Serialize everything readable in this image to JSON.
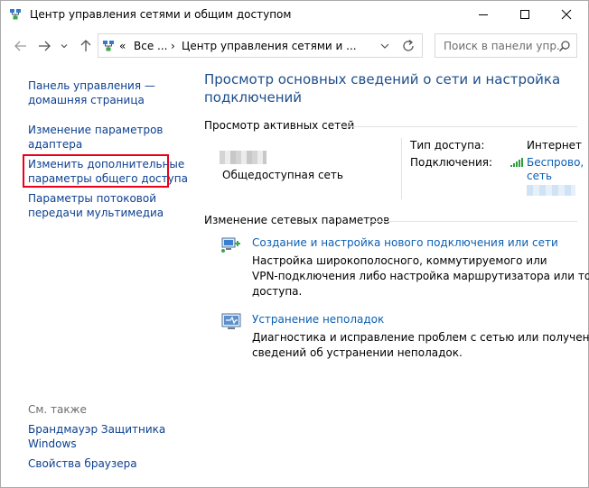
{
  "window": {
    "title": "Центр управления сетями и общим доступом"
  },
  "address": {
    "chevrons": "«",
    "crumb1": "Все ...",
    "sep": "›",
    "crumb2": "Центр управления сетями и ..."
  },
  "search": {
    "placeholder": "Поиск в панели упр..."
  },
  "sidebar": {
    "home": [
      "Панель управления —",
      "домашняя страница"
    ],
    "adapter": [
      "Изменение параметров",
      "адаптера"
    ],
    "sharing": [
      "Изменить дополнительные",
      "параметры общего доступа"
    ],
    "streaming": [
      "Параметры потоковой",
      "передачи мультимедиа"
    ],
    "see_also": "См. также",
    "firewall": [
      "Брандмауэр Защитника",
      "Windows"
    ],
    "browser": "Свойства браузера"
  },
  "main": {
    "heading": [
      "Просмотр основных сведений о сети и настройка",
      "подключений"
    ],
    "active_networks_label": "Просмотр активных сетей",
    "network_type": "Общедоступная сеть",
    "access_type_label": "Тип доступа:",
    "access_type_value": "Интернет",
    "connections_label": "Подключения:",
    "connection_value": [
      "Беспрово,",
      "сеть"
    ],
    "change_settings_label": "Изменение сетевых параметров",
    "tasks": [
      {
        "link": "Создание и настройка нового подключения или сети",
        "desc": [
          "Настройка широкополосного, коммутируемого или",
          "VPN-подключения либо настройка маршрутизатора или точки",
          "доступа."
        ]
      },
      {
        "link": "Устранение неполадок",
        "desc": [
          "Диагностика и исправление проблем с сетью или получение",
          "сведений об устранении неполадок."
        ]
      }
    ]
  },
  "colors": {
    "link": "#0b5fb3",
    "nav_link": "#0b3f8f",
    "heading": "#1e4e8c",
    "highlight": "#e8001c"
  },
  "icons": {
    "title": "network-center-icon",
    "back": "arrow-left-icon",
    "forward": "arrow-right-icon",
    "up": "arrow-up-icon",
    "refresh": "refresh-icon",
    "search": "search-icon",
    "wifi": "wifi-signal-icon"
  }
}
